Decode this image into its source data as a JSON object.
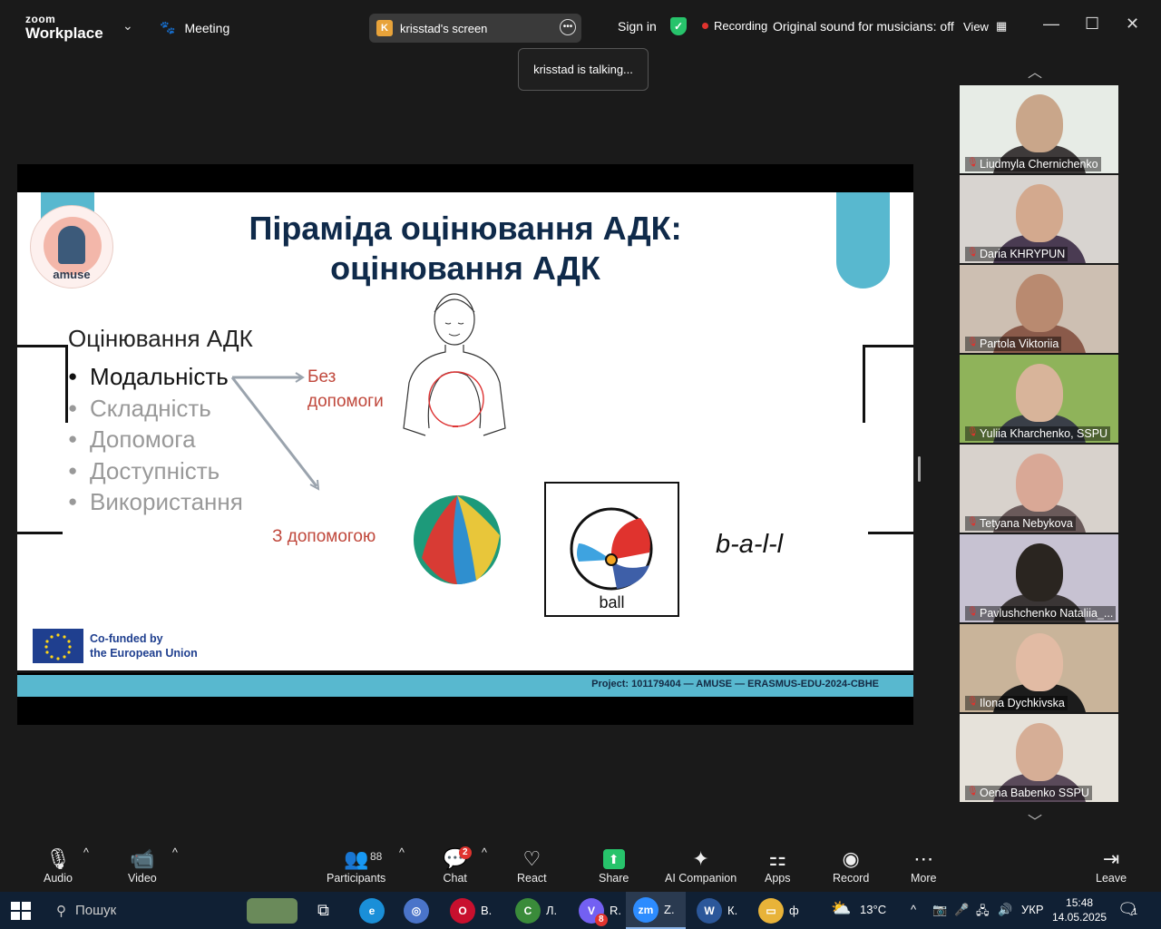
{
  "titlebar": {
    "brand_top": "zoom",
    "brand_bottom": "Workplace",
    "meeting_label": "Meeting",
    "screen_share_label": "krisstad's screen",
    "screen_share_initial": "K",
    "signin_label": "Sign in",
    "recording_label": "Recording",
    "original_sound_label": "Original sound for musicians: off",
    "view_label": "View"
  },
  "tooltip": {
    "text": "krisstad is talking..."
  },
  "slide": {
    "title_line1": "Піраміда оцінювання АДК:",
    "title_line2": "оцінювання АДК",
    "logo_text": "amuse",
    "criteria_heading": "Оцінювання АДК",
    "criteria": [
      {
        "label": "Модальність",
        "active": true
      },
      {
        "label": "Складність",
        "active": false
      },
      {
        "label": "Допомога",
        "active": false
      },
      {
        "label": "Доступність",
        "active": false
      },
      {
        "label": "Використання",
        "active": false
      }
    ],
    "no_help_line1": "Без",
    "no_help_line2": "допомоги",
    "with_help": "З допомогою",
    "symbol_label": "ball",
    "fingerspelling": "b-a-l-l",
    "eu_line1": "Co-funded by",
    "eu_line2": "the European Union",
    "footer_project": "Project: 101179404 — AMUSE — ERASMUS-EDU-2024-CBHE",
    "colors": {
      "teal": "#58b8cf",
      "title_navy": "#0f2a4a",
      "accent_red": "#c0483c"
    }
  },
  "participants": [
    {
      "name": "Liudmyla Chernichenko",
      "bg": "#e7ece6",
      "face": "#c9a68a",
      "body": "#3e3a3a"
    },
    {
      "name": "Daria KHRYPUN",
      "bg": "#d8d4d0",
      "face": "#d3a98e",
      "body": "#4a3b52"
    },
    {
      "name": "Partola Viktoriia",
      "bg": "#cdbfb2",
      "face": "#b98a70",
      "body": "#8a5a4a"
    },
    {
      "name": "Yuliia Kharchenko, SSPU",
      "bg": "#8fb35a",
      "face": "#d8b49a",
      "body": "#3a3f48"
    },
    {
      "name": "Tetyana Nebykova",
      "bg": "#d8d2cc",
      "face": "#d9a896",
      "body": "#6a5a5a"
    },
    {
      "name": "Pavlushchenko Nataliia_...",
      "bg": "#c7c2d2",
      "face": "#2a2520",
      "body": "#3a3535"
    },
    {
      "name": "Ilona Dychkivska",
      "bg": "#c9b49a",
      "face": "#e2bba4",
      "body": "#1c1c1c"
    },
    {
      "name": "Oena Babenko SSPU",
      "bg": "#e6e2da",
      "face": "#d6ae96",
      "body": "#5a4a5a"
    }
  ],
  "toolbar": {
    "audio": "Audio",
    "video": "Video",
    "participants": "Participants",
    "participants_count": "88",
    "chat": "Chat",
    "chat_badge": "2",
    "react": "React",
    "share": "Share",
    "ai_companion": "AI Companion",
    "apps": "Apps",
    "record": "Record",
    "more": "More",
    "leave": "Leave"
  },
  "taskbar": {
    "search_placeholder": "Пошук",
    "apps": [
      {
        "id": "opera",
        "label": "В.",
        "color": "#c8102e",
        "letter": "O"
      },
      {
        "id": "chrome",
        "label": "Л.",
        "color": "#3a8b3a",
        "letter": "C"
      },
      {
        "id": "viber",
        "label": "R.",
        "color": "#7360f2",
        "letter": "V",
        "badge": "8"
      },
      {
        "id": "zoom",
        "label": "Z.",
        "color": "#2d8cff",
        "letter": "zm"
      },
      {
        "id": "word",
        "label": "К.",
        "color": "#2b579a",
        "letter": "W"
      },
      {
        "id": "explorer",
        "label": "ф",
        "color": "#e8b339",
        "letter": "▭"
      }
    ],
    "weather": "13°C",
    "language": "УКР",
    "time": "15:48",
    "date": "14.05.2025",
    "notifications": "1"
  }
}
